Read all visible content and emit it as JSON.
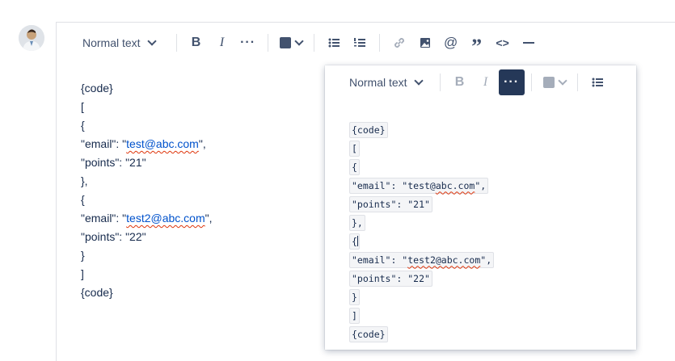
{
  "editor": {
    "toolbar": {
      "text_style": "Normal text",
      "text_color": "#42526e"
    },
    "lines": [
      "{code}",
      "[",
      "{",
      "EMAIL1",
      "\"points\": \"21\"",
      "},",
      "{",
      "EMAIL2",
      "\"points\": \"22\"",
      "}",
      "]",
      "{code}"
    ],
    "email_lines": [
      {
        "prefix": "\"email\": \"",
        "link": "test@abc.com",
        "suffix": "\","
      },
      {
        "prefix": "\"email\": \"",
        "link": "test2@abc.com",
        "suffix": "\","
      }
    ]
  },
  "popup": {
    "toolbar": {
      "text_style": "Normal text",
      "active_button": "more-formatting"
    },
    "code_lines": [
      {
        "text": "{code}"
      },
      {
        "text": "["
      },
      {
        "text": "{"
      },
      {
        "prefix": "\"email\": \"test@",
        "misspelled": "abc.com",
        "suffix": "\","
      },
      {
        "text": "\"points\": \"21\""
      },
      {
        "text": "},"
      },
      {
        "text": "{"
      },
      {
        "prefix": "\"email\": \"",
        "misspelled": "test2@abc.com",
        "suffix": "\","
      },
      {
        "text": "\"points\": \"22\""
      },
      {
        "text": "}"
      },
      {
        "text": "]"
      },
      {
        "text": "{code}"
      }
    ]
  },
  "colors": {
    "link": "#0052cc",
    "active_button_bg": "#253858",
    "swatch_main": "#42526e",
    "swatch_popup": "#a5adba"
  }
}
